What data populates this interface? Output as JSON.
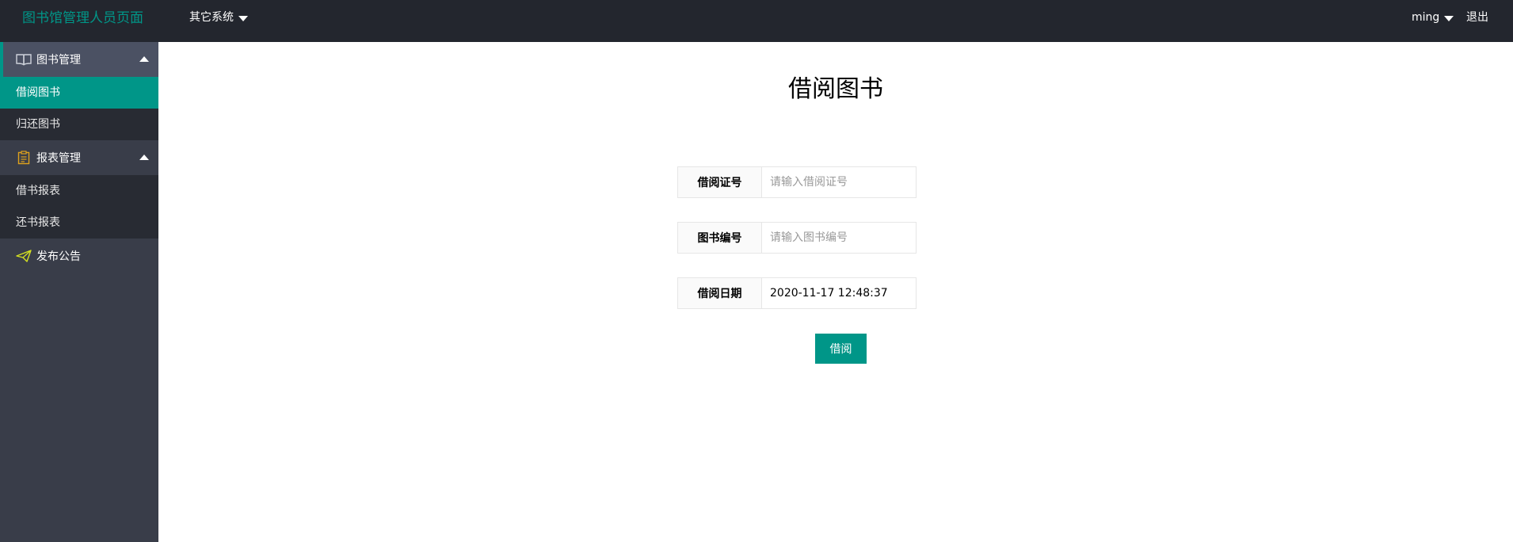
{
  "header": {
    "logo": "图书馆管理人员页面",
    "other_system": "其它系统",
    "user": "ming",
    "logout": "退出"
  },
  "sidebar": {
    "groups": [
      {
        "label": "图书管理",
        "icon": "book-icon",
        "items": [
          {
            "label": "借阅图书",
            "active": true
          },
          {
            "label": "归还图书",
            "active": false
          }
        ]
      },
      {
        "label": "报表管理",
        "icon": "clipboard-icon",
        "items": [
          {
            "label": "借书报表",
            "active": false
          },
          {
            "label": "还书报表",
            "active": false
          }
        ]
      },
      {
        "label": "发布公告",
        "icon": "paper-plane-icon"
      }
    ]
  },
  "main": {
    "title": "借阅图书",
    "form": {
      "card": {
        "label": "借阅证号",
        "placeholder": "请输入借阅证号",
        "value": ""
      },
      "book": {
        "label": "图书编号",
        "placeholder": "请输入图书编号",
        "value": ""
      },
      "date": {
        "label": "借阅日期",
        "placeholder": "",
        "value": "2020-11-17 12:48:37"
      }
    },
    "submit_label": "借阅"
  },
  "colors": {
    "accent": "#009688",
    "header_bg": "#23262e",
    "sidebar_bg": "#393d49",
    "submenu_bg": "#282b33"
  }
}
